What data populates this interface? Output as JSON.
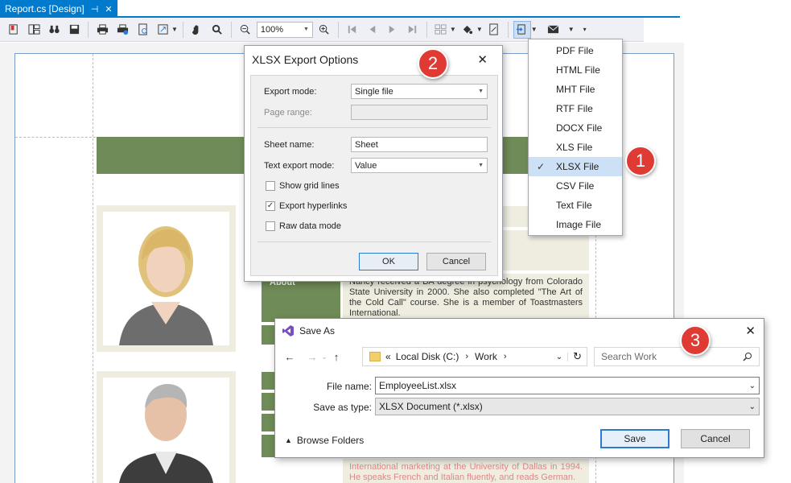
{
  "doc_tab": {
    "title": "Report.cs [Design]",
    "pin": "⊣",
    "close": "✕"
  },
  "toolbar": {
    "zoom": "100%"
  },
  "export_menu": {
    "items": [
      {
        "label": "PDF File",
        "selected": false
      },
      {
        "label": "HTML File",
        "selected": false
      },
      {
        "label": "MHT File",
        "selected": false
      },
      {
        "label": "RTF File",
        "selected": false
      },
      {
        "label": "DOCX File",
        "selected": false
      },
      {
        "label": "XLS File",
        "selected": false
      },
      {
        "label": "XLSX File",
        "selected": true
      },
      {
        "label": "CSV File",
        "selected": false
      },
      {
        "label": "Text File",
        "selected": false
      },
      {
        "label": "Image File",
        "selected": false
      }
    ]
  },
  "badges": {
    "one": "1",
    "two": "2",
    "three": "3"
  },
  "xlsx_dialog": {
    "title": "XLSX Export Options",
    "close": "✕",
    "export_mode_label": "Export mode:",
    "export_mode_value": "Single file",
    "page_range_label": "Page range:",
    "page_range_value": "",
    "sheet_name_label": "Sheet name:",
    "sheet_name_value": "Sheet",
    "text_export_label": "Text export mode:",
    "text_export_value": "Value",
    "show_grid_lines": {
      "label": "Show grid lines",
      "checked": false
    },
    "export_hyperlinks": {
      "label": "Export hyperlinks",
      "checked": true
    },
    "raw_data_mode": {
      "label": "Raw data mode",
      "checked": false
    },
    "ok": "OK",
    "cancel": "Cancel"
  },
  "save_dialog": {
    "title": "Save As",
    "close": "✕",
    "path_prefix": "«",
    "path_drive": "Local Disk (C:)",
    "path_folder": "Work",
    "search_placeholder": "Search Work",
    "file_name_label": "File name:",
    "file_name_value": "EmployeeList.xlsx",
    "save_type_label": "Save as type:",
    "save_type_value": "XLSX Document (*.xlsx)",
    "browse_folders": "Browse Folders",
    "save": "Save",
    "cancel": "Cancel"
  },
  "report": {
    "about_label": "About",
    "about_text": "Nancy received a BA degree in psychology from Colorado State University in 2000. She also completed \"The Art of the Cold Call\" course. She is a member of Toastmasters International.",
    "bottom_text": "International marketing at the University of Dallas in 1994. He speaks French and Italian fluently, and reads German."
  }
}
